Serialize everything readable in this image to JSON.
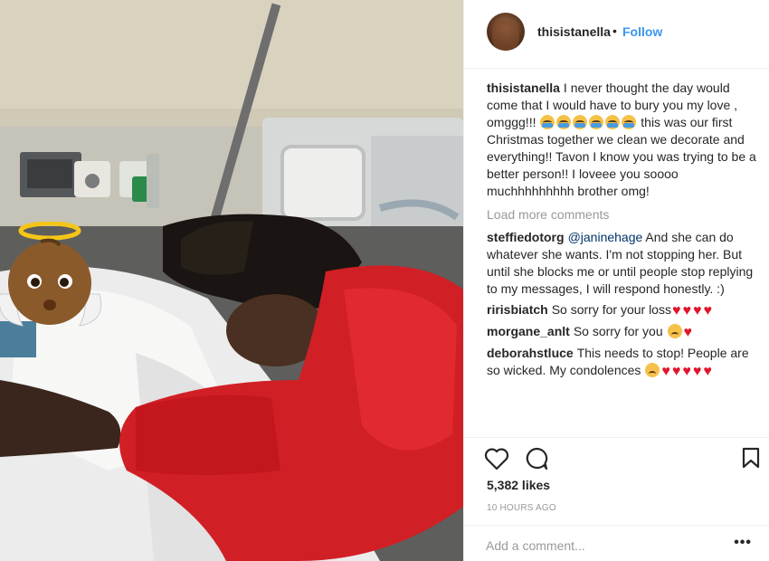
{
  "header": {
    "username": "thisistanella",
    "separator": "•",
    "follow_label": "Follow"
  },
  "caption": {
    "username": "thisistanella",
    "text_part1": "I never thought the day would come that I would have to bury you my love , omggg!!! ",
    "emoji_count": 6,
    "emoji_icon": "loudly-crying-face-icon",
    "text_part2": " this was our first Christmas together we clean we decorate and everything!! Tavon I know you was trying to be a better person!! I loveee you soooo muchhhhhhhhh brother omg!"
  },
  "load_more_label": "Load more comments",
  "comments": [
    {
      "username": "steffiedotorg",
      "mention": "@janinehage",
      "text": " And she can do whatever she wants. I'm not stopping her. But until she blocks me or until people stop replying to my messages, I will respond honestly. :)"
    },
    {
      "username": "ririsbiatch",
      "text": "So sorry for your loss",
      "hearts": 4
    },
    {
      "username": "morgane_anlt",
      "text": "So sorry for you ",
      "emoji_icon": "disappointed-face-icon",
      "hearts": 1
    },
    {
      "username": "deborahstluce",
      "text": "This needs to stop! People are so wicked. My condolences ",
      "emoji_icon": "weary-face-icon",
      "hearts": 5
    }
  ],
  "actions": {
    "like_icon": "heart-outline-icon",
    "comment_icon": "speech-bubble-icon",
    "save_icon": "bookmark-icon"
  },
  "likes_label": "5,382 likes",
  "timestamp": "10 HOURS AGO",
  "add_comment": {
    "placeholder": "Add a comment...",
    "more_label": "•••"
  },
  "colors": {
    "link_blue": "#3897f0",
    "heart_red": "#e0152b",
    "muted_gray": "#999999"
  },
  "photo": {
    "sticker_icon": "baby-angel-emoji-icon"
  }
}
